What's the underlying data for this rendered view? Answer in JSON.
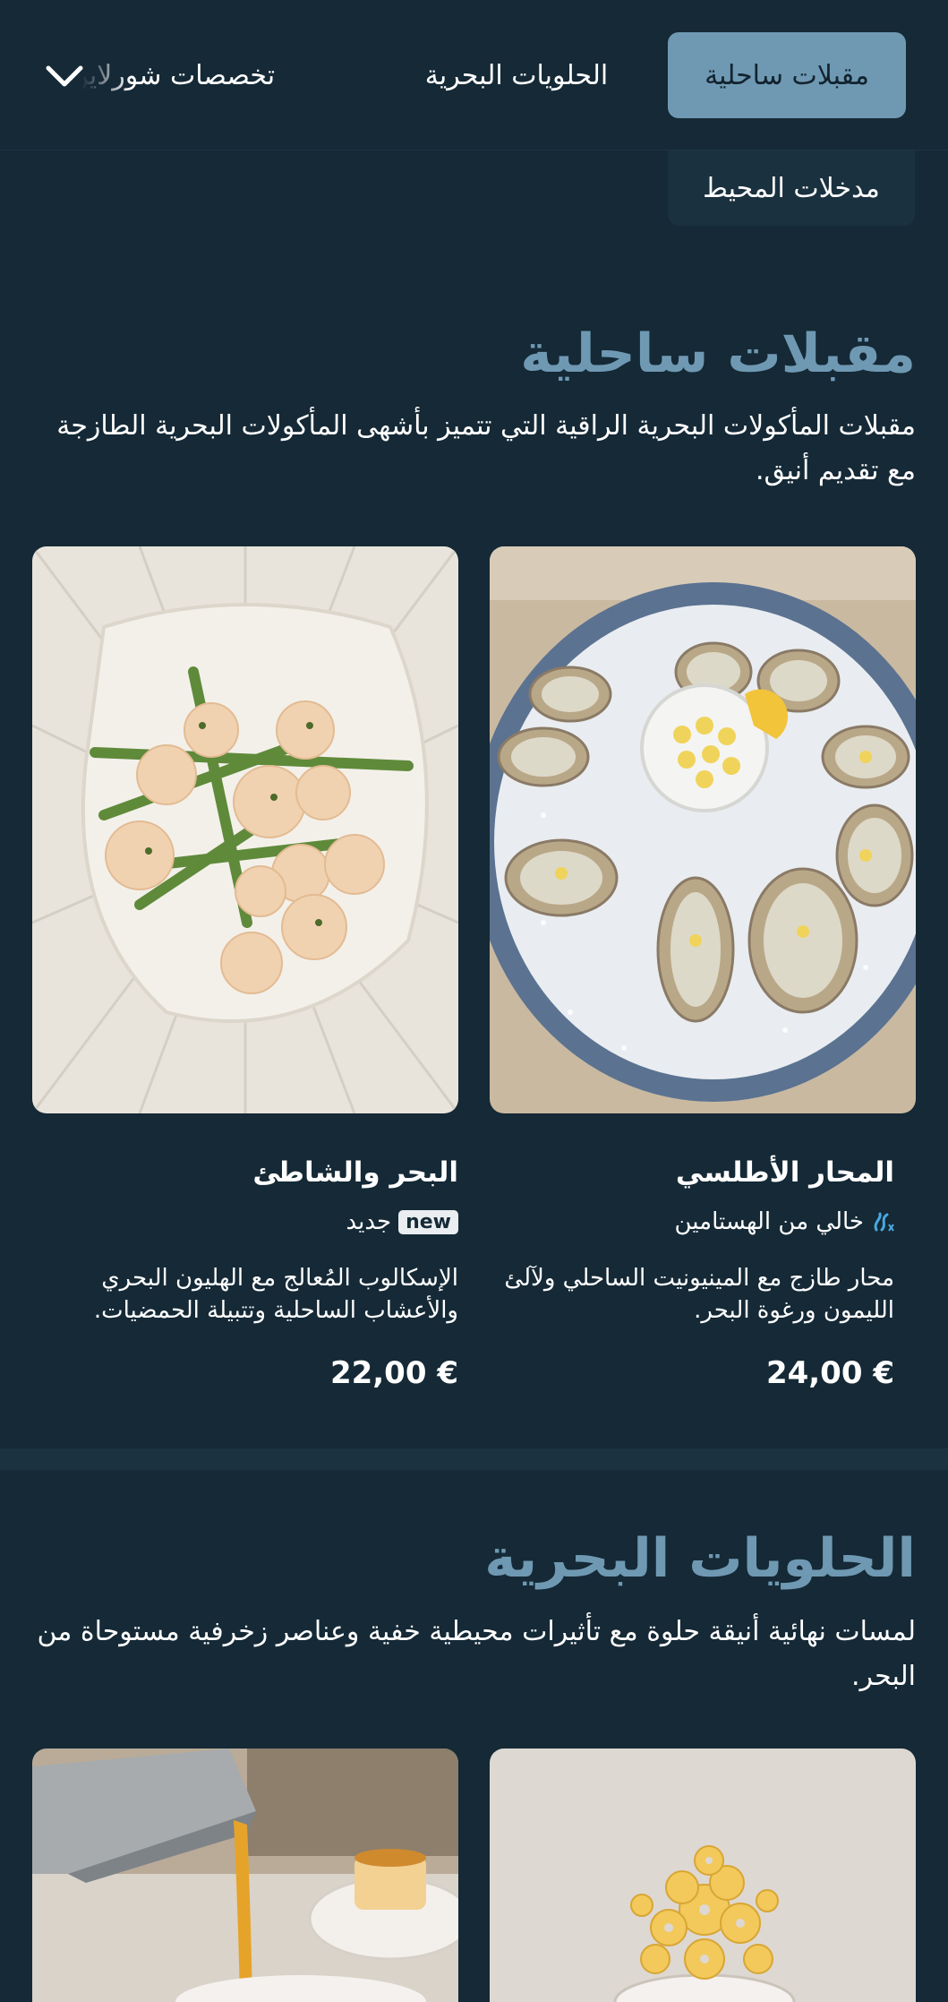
{
  "nav": {
    "tabs": [
      {
        "label": "مقبلات ساحلية",
        "active": true
      },
      {
        "label": "الحلويات البحرية",
        "active": false
      },
      {
        "label": "تخصصات شورلاين",
        "active": false
      },
      {
        "label": "مدخلات المحيط",
        "active": false
      }
    ],
    "expand_icon": "chevron-down-icon"
  },
  "sections": [
    {
      "title": "مقبلات ساحلية",
      "description": "مقبلات المأكولات البحرية الراقية التي تتميز بأشهى المأكولات البحرية الطازجة مع تقديم أنيق.",
      "items": [
        {
          "name": "المحار الأطلسي",
          "tag_label": "خالي من الهستامين",
          "tag_icon": "histamine-free-icon",
          "description": "محار طازج مع المينيونيت الساحلي ولآلئ الليمون ورغوة البحر.",
          "price": "24,00 €",
          "image": "oysters-on-salt-plate"
        },
        {
          "name": "البحر والشاطئ",
          "tag_badge": "new",
          "tag_label": "جديد",
          "description": "الإسكالوب المُعالج مع الهليون البحري والأعشاب الساحلية وتتبيلة الحمضيات.",
          "price": "22,00 €",
          "image": "scallops-with-asparagus"
        }
      ]
    },
    {
      "title": "الحلويات البحرية",
      "description": "لمسات نهائية أنيقة حلوة مع تأثيرات محيطية خفية وعناصر زخرفية مستوحاة من البحر.",
      "items": [
        {
          "image": "coral-tuile-dessert"
        },
        {
          "image": "sauce-pour-flan"
        }
      ]
    }
  ],
  "colors": {
    "background": "#152936",
    "accent": "#6f99b3",
    "active_tab_text": "#12232e",
    "histamine_icon": "#4aa8e0"
  }
}
